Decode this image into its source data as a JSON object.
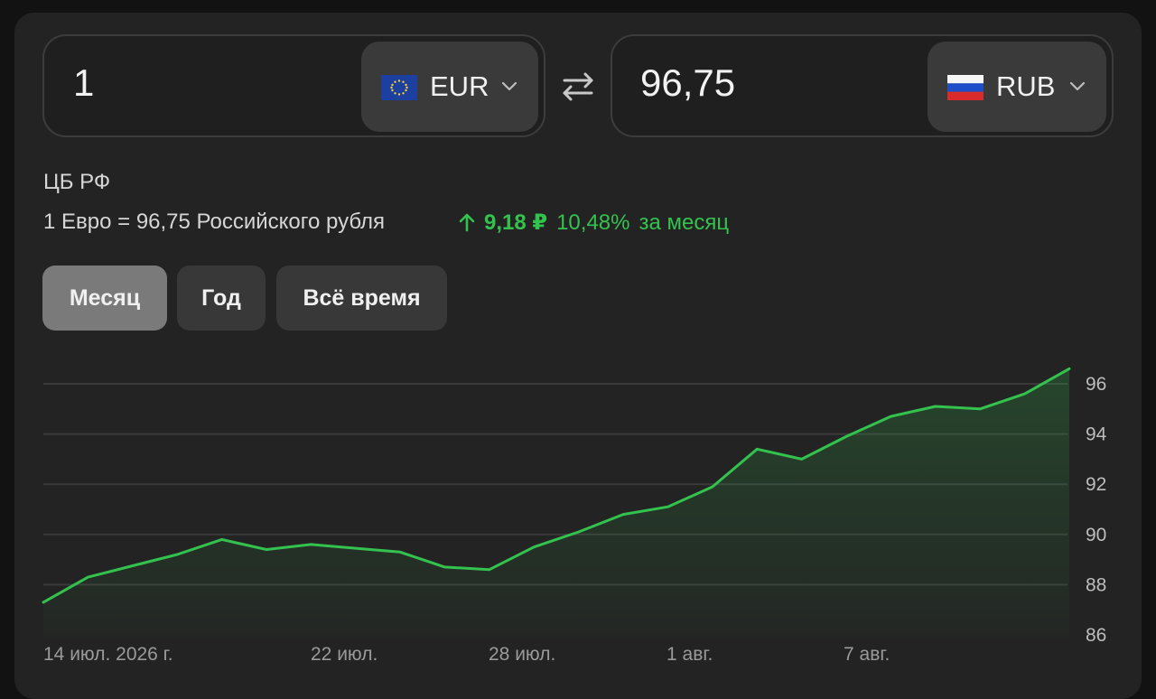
{
  "converter": {
    "from": {
      "amount": "1",
      "currency": "EUR",
      "flag_icon": "eu-flag-icon"
    },
    "to": {
      "amount": "96,75",
      "currency": "RUB",
      "flag_icon": "ru-flag-icon"
    },
    "swap_icon": "swap-arrows-icon"
  },
  "source": "ЦБ РФ",
  "rate_text": "1 Евро = 96,75 Российского рубля",
  "change": {
    "direction": "up",
    "delta": "9,18 ₽",
    "percent": "10,48%",
    "period": "за месяц",
    "color": "#34c24e"
  },
  "tabs": [
    {
      "label": "Месяц",
      "active": true
    },
    {
      "label": "Год",
      "active": false
    },
    {
      "label": "Всё время",
      "active": false
    }
  ],
  "chart_data": {
    "type": "area",
    "y_ticks": [
      "96",
      "94",
      "92",
      "90",
      "88",
      "86"
    ],
    "ylim": [
      86,
      96.5
    ],
    "x_tick_labels": [
      "14 июл. 2026 г.",
      "22 июл.",
      "28 июл.",
      "1 авг.",
      "7 авг."
    ],
    "series": [
      {
        "values": [
          87.3,
          88.3,
          88.75,
          89.2,
          89.8,
          89.4,
          89.6,
          89.45,
          89.3,
          88.7,
          88.6,
          89.5,
          90.1,
          90.8,
          91.1,
          91.9,
          93.4,
          93.0,
          93.9,
          94.7,
          95.1,
          95.0,
          95.6,
          96.6
        ],
        "color": "#34c24e"
      }
    ],
    "grid": true,
    "y_axis_position": "right"
  }
}
